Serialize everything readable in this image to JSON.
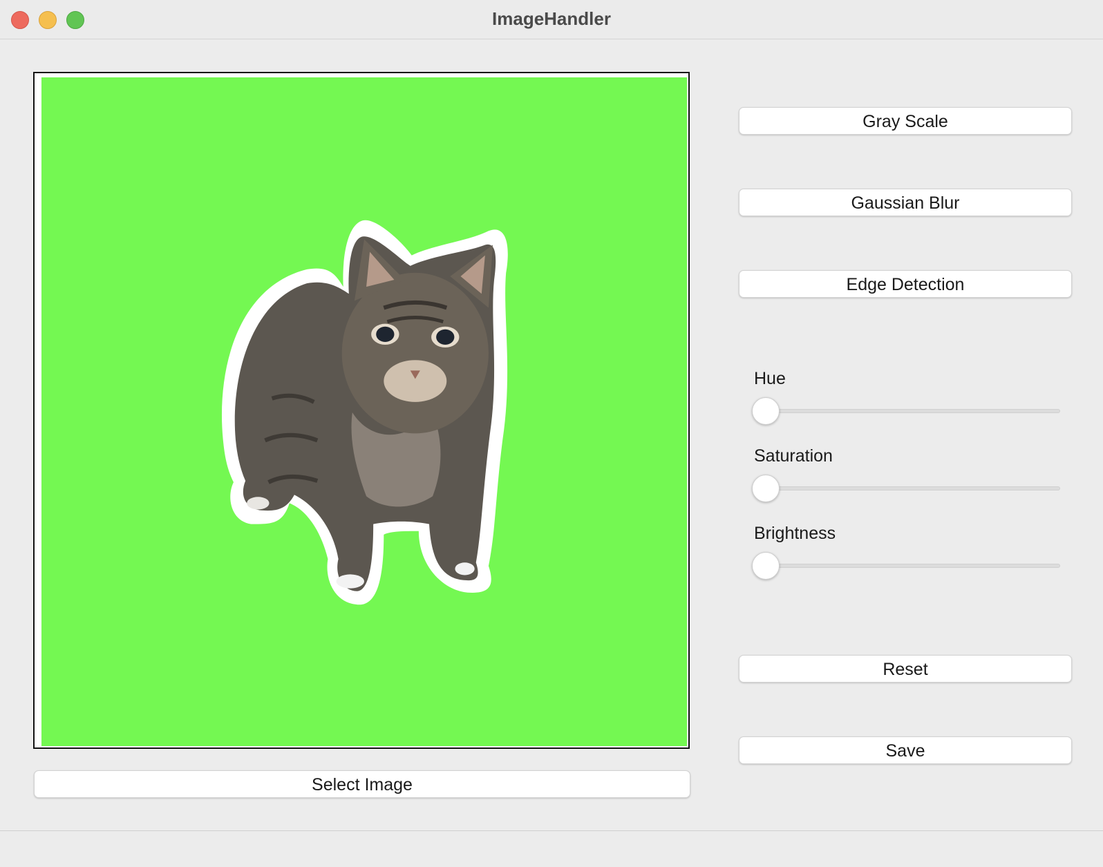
{
  "window": {
    "title": "ImageHandler"
  },
  "image": {
    "subject": "cat on green background",
    "background_color": "#74f852"
  },
  "buttons": {
    "gray_scale": "Gray Scale",
    "gaussian_blur": "Gaussian Blur",
    "edge_detection": "Edge Detection",
    "reset": "Reset",
    "save": "Save",
    "select_image": "Select Image"
  },
  "sliders": [
    {
      "label": "Hue",
      "value": 0
    },
    {
      "label": "Saturation",
      "value": 0
    },
    {
      "label": "Brightness",
      "value": 0
    }
  ]
}
